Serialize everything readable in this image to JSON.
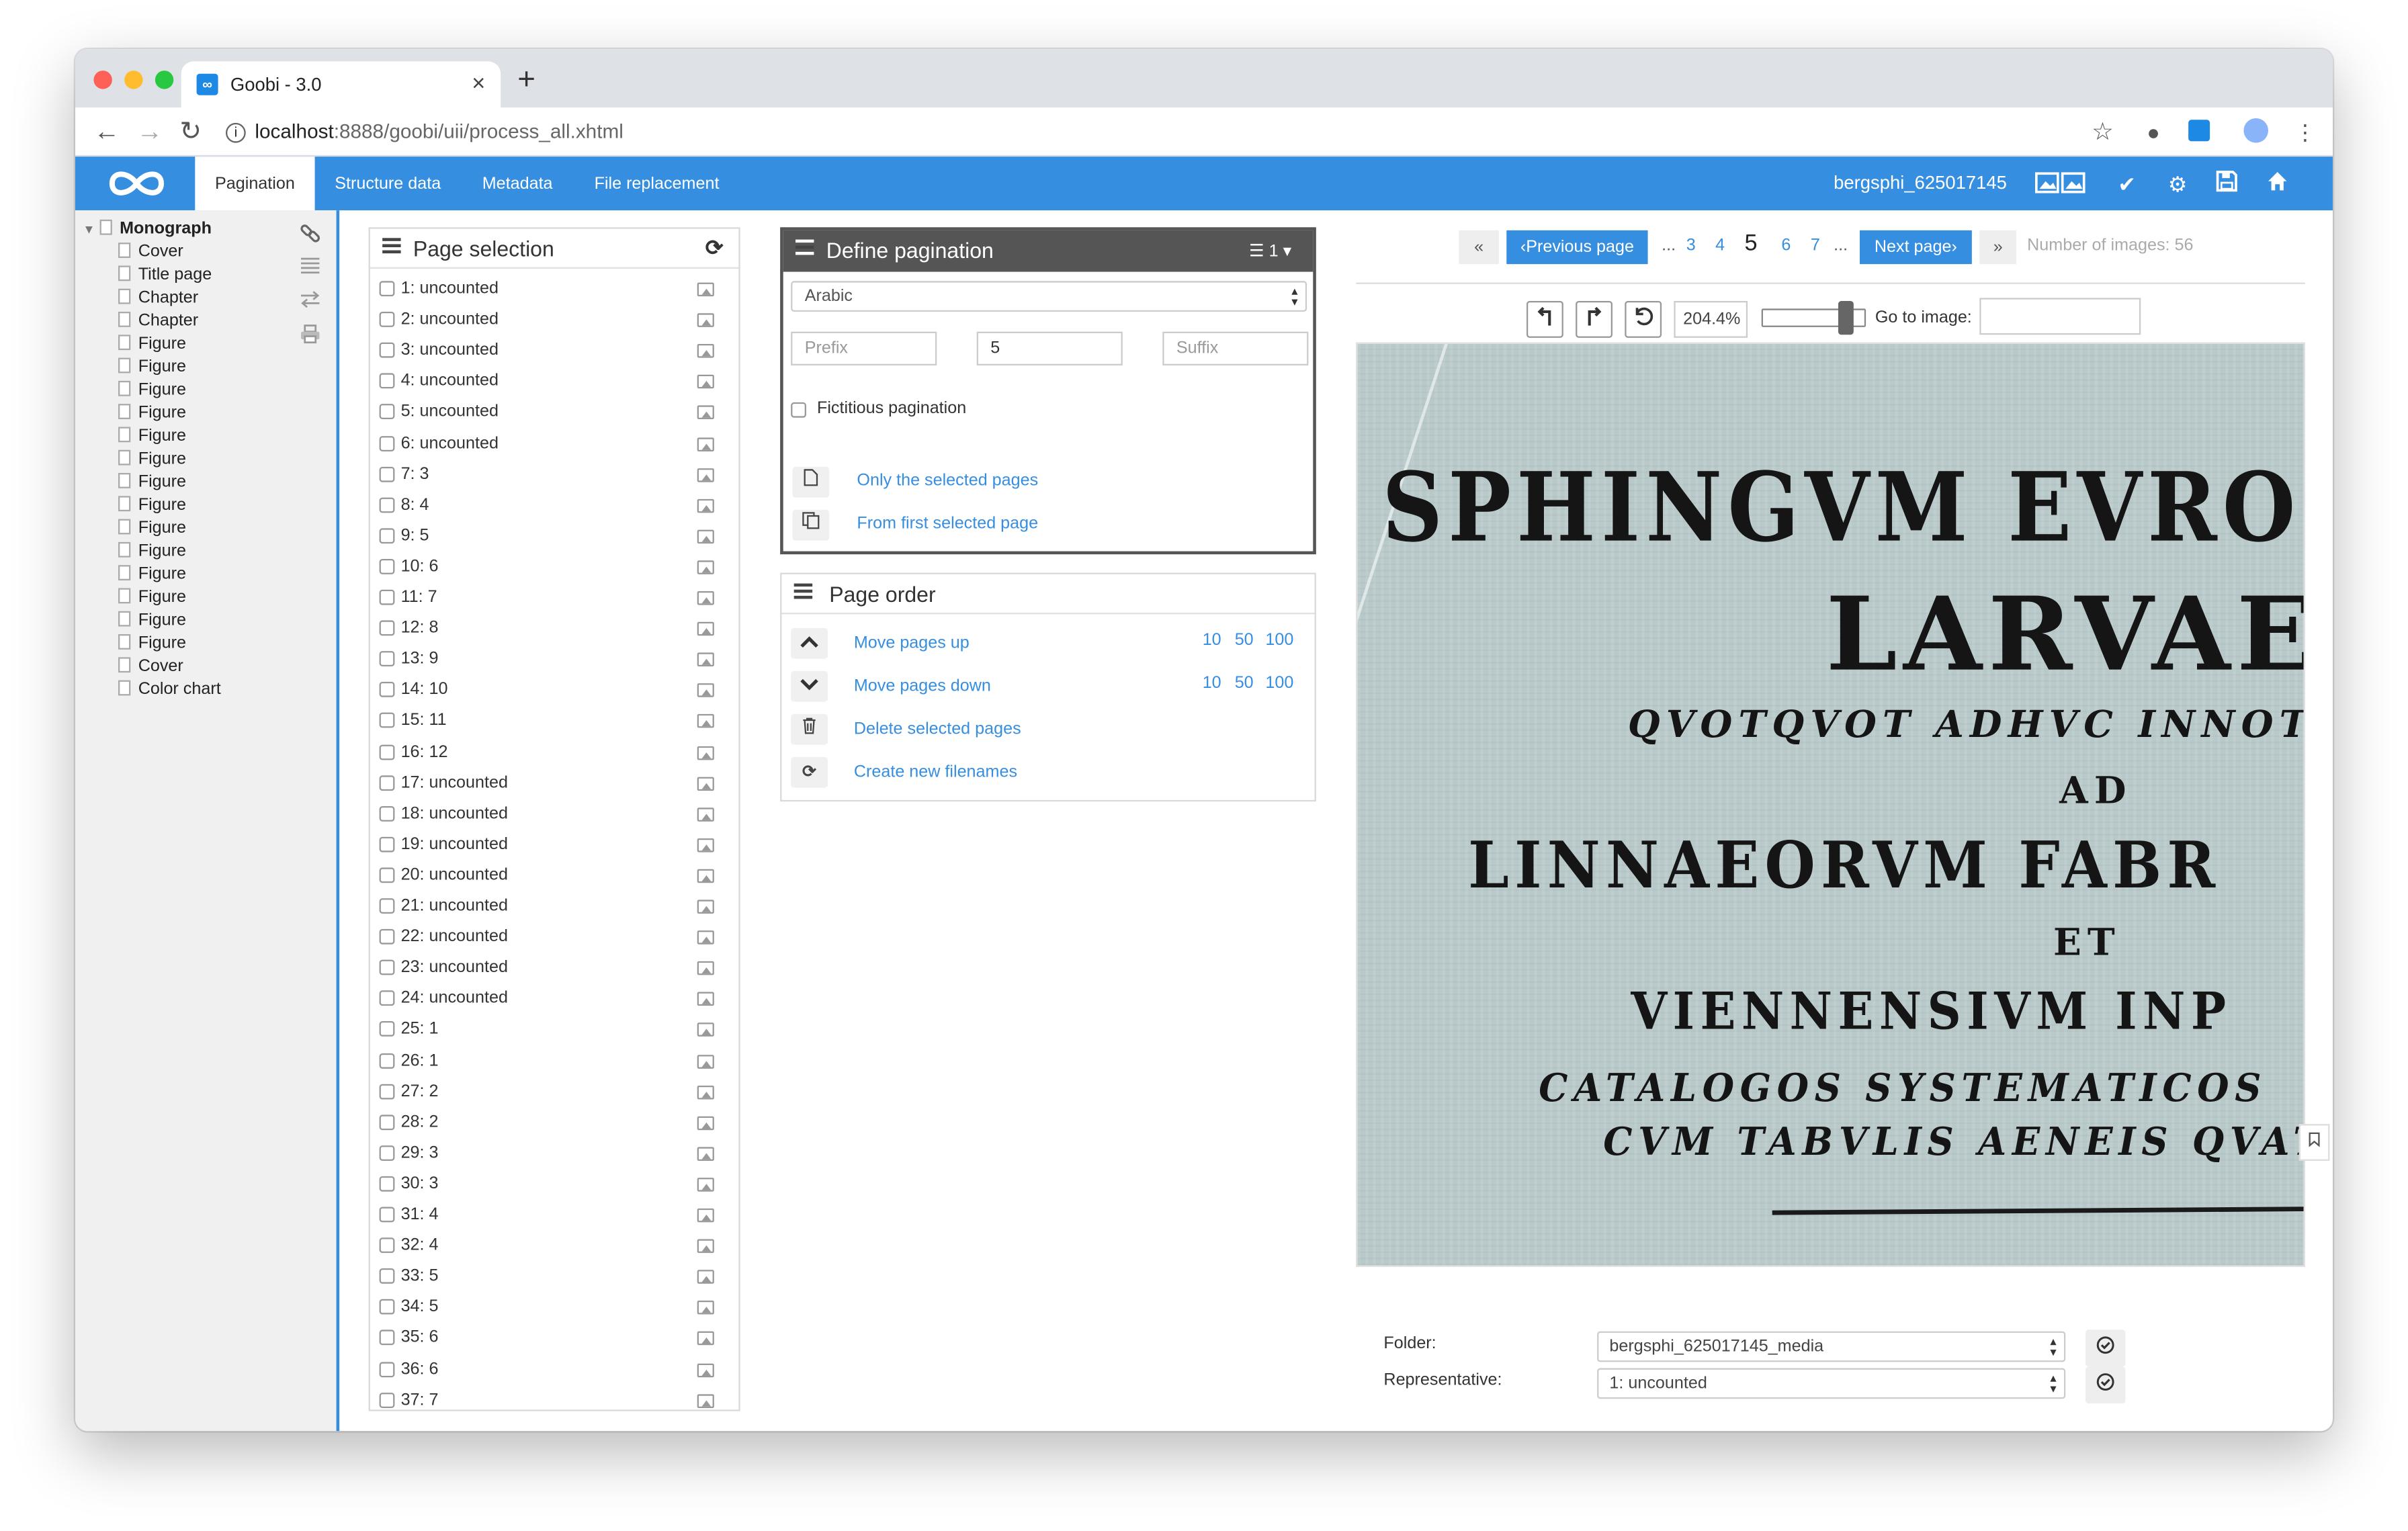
{
  "browser": {
    "tab_title": "Goobi - 3.0",
    "url_host": "localhost",
    "url_path": ":8888/goobi/uii/process_all.xhtml"
  },
  "appbar": {
    "tabs": [
      "Pagination",
      "Structure data",
      "Metadata",
      "File replacement"
    ],
    "active_tab": "Pagination",
    "process_name": "bergsphi_625017145",
    "brand_color": "#368ee0"
  },
  "tree": {
    "root": "Monograph",
    "items": [
      "Cover",
      "Title page",
      "Chapter",
      "Chapter",
      "Figure",
      "Figure",
      "Figure",
      "Figure",
      "Figure",
      "Figure",
      "Figure",
      "Figure",
      "Figure",
      "Figure",
      "Figure",
      "Figure",
      "Figure",
      "Figure",
      "Cover",
      "Color chart"
    ]
  },
  "page_selection": {
    "title": "Page selection",
    "pages": [
      "1: uncounted",
      "2: uncounted",
      "3: uncounted",
      "4: uncounted",
      "5: uncounted",
      "6: uncounted",
      "7: 3",
      "8: 4",
      "9: 5",
      "10: 6",
      "11: 7",
      "12: 8",
      "13: 9",
      "14: 10",
      "15: 11",
      "16: 12",
      "17: uncounted",
      "18: uncounted",
      "19: uncounted",
      "20: uncounted",
      "21: uncounted",
      "22: uncounted",
      "23: uncounted",
      "24: uncounted",
      "25: 1",
      "26: 1",
      "27: 2",
      "28: 2",
      "29: 3",
      "30: 3",
      "31: 4",
      "32: 4",
      "33: 5",
      "34: 5",
      "35: 6",
      "36: 6",
      "37: 7"
    ]
  },
  "define_pagination": {
    "title": "Define pagination",
    "count_badge": "1",
    "type": "Arabic",
    "prefix_placeholder": "Prefix",
    "start_value": "5",
    "suffix_placeholder": "Suffix",
    "fictitious_label": "Fictitious pagination",
    "only_selected": "Only the selected pages",
    "from_first": "From first selected page"
  },
  "page_order": {
    "title": "Page order",
    "move_up": "Move pages up",
    "move_down": "Move pages down",
    "delete": "Delete selected pages",
    "new_filenames": "Create new filenames",
    "steps": [
      "10",
      "50",
      "100"
    ]
  },
  "viewer": {
    "first_label": "«",
    "previous": "Previous page",
    "pages": [
      "3",
      "4",
      "5",
      "6",
      "7"
    ],
    "current_page": "5",
    "ellipsis": "...",
    "next": "Next page",
    "last_label": "»",
    "images_count": "Number of images: 56",
    "zoom": "204.4%",
    "zoom_level": 0.85,
    "goto_label": "Go to image:",
    "scan_lines": [
      "SPHINGVM  EVROP",
      "LARVAE",
      "QVOTQVOT ADHVC INNOT",
      "AD",
      "LINNAEORVM  FABR",
      "ET",
      "VIENNENSIVM  INP",
      "CATALOGOS  SYSTEMATICOS",
      "CVM TABVLIS AENEIS QVAT"
    ]
  },
  "bottom": {
    "folder_label": "Folder:",
    "folder_value": "bergsphi_625017145_media",
    "representative_label": "Representative:",
    "representative_value": "1: uncounted"
  }
}
